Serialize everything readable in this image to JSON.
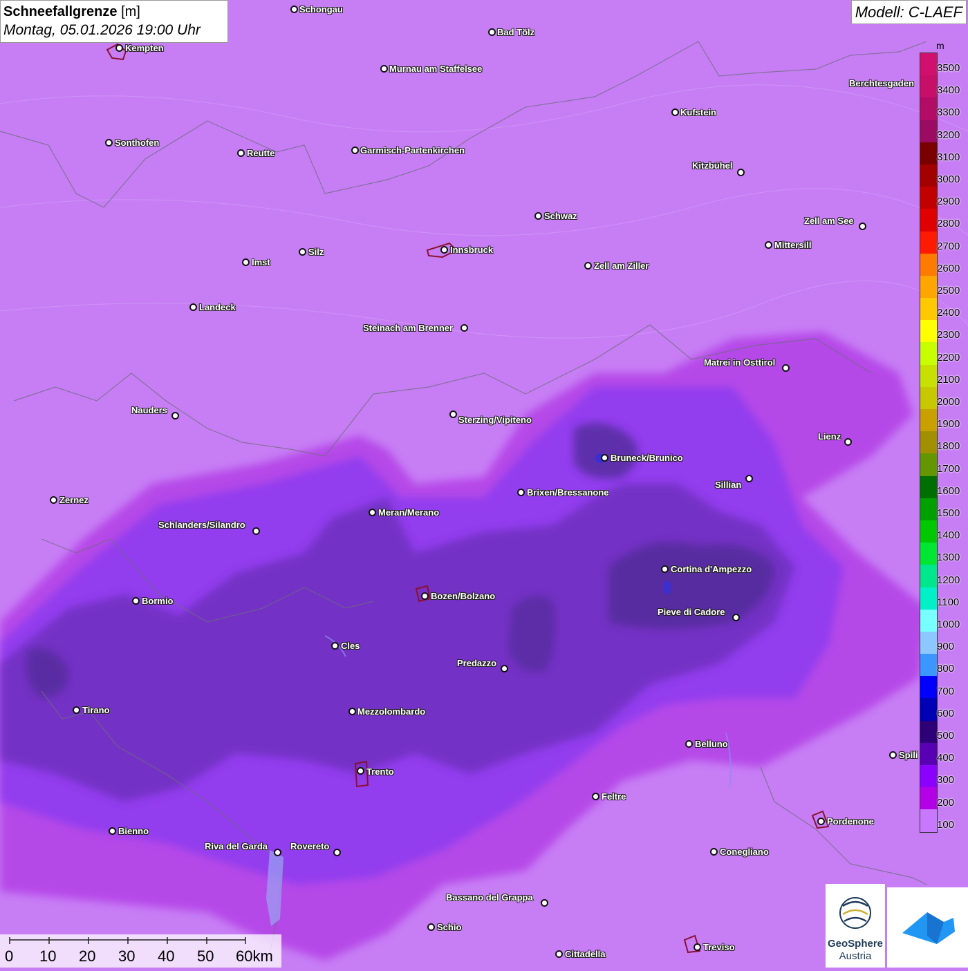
{
  "header": {
    "title": "Schneefallgrenze",
    "unit": "[m]",
    "datetime": "Montag, 05.01.2026 19:00 Uhr",
    "model": "Modell: C-LAEF"
  },
  "legend": {
    "unit": "m",
    "levels": [
      {
        "label": "3500",
        "color": "#d10f6e"
      },
      {
        "label": "3400",
        "color": "#c70e69"
      },
      {
        "label": "3300",
        "color": "#b20c66"
      },
      {
        "label": "3200",
        "color": "#9c0b62"
      },
      {
        "label": "3100",
        "color": "#7a0000"
      },
      {
        "label": "3000",
        "color": "#a30000"
      },
      {
        "label": "2900",
        "color": "#c30000"
      },
      {
        "label": "2800",
        "color": "#e00000"
      },
      {
        "label": "2700",
        "color": "#ff1a00"
      },
      {
        "label": "2600",
        "color": "#ff7a00"
      },
      {
        "label": "2500",
        "color": "#ffa500"
      },
      {
        "label": "2400",
        "color": "#ffc800"
      },
      {
        "label": "2300",
        "color": "#ffff00"
      },
      {
        "label": "2200",
        "color": "#c8ff00"
      },
      {
        "label": "2100",
        "color": "#c8e000"
      },
      {
        "label": "2000",
        "color": "#c8c800"
      },
      {
        "label": "1900",
        "color": "#c8a000"
      },
      {
        "label": "1800",
        "color": "#a09000"
      },
      {
        "label": "1700",
        "color": "#649600"
      },
      {
        "label": "1600",
        "color": "#006e00"
      },
      {
        "label": "1500",
        "color": "#00a000"
      },
      {
        "label": "1400",
        "color": "#00c800"
      },
      {
        "label": "1300",
        "color": "#00e632"
      },
      {
        "label": "1200",
        "color": "#00e68c"
      },
      {
        "label": "1100",
        "color": "#00f0c8"
      },
      {
        "label": "1000",
        "color": "#78ffff"
      },
      {
        "label": "900",
        "color": "#8cc8ff"
      },
      {
        "label": "800",
        "color": "#3c96ff"
      },
      {
        "label": "700",
        "color": "#0000ff"
      },
      {
        "label": "600",
        "color": "#0000b4"
      },
      {
        "label": "500",
        "color": "#2d0078"
      },
      {
        "label": "400",
        "color": "#5a00b4"
      },
      {
        "label": "300",
        "color": "#8c00ff"
      },
      {
        "label": "200",
        "color": "#b400e6"
      },
      {
        "label": "100",
        "color": "#c878ff"
      }
    ]
  },
  "cities": [
    {
      "name": "Schongau",
      "dot": true
    },
    {
      "name": "Bad Tölz",
      "dot": true
    },
    {
      "name": "Kempten",
      "dot": true
    },
    {
      "name": "Murnau am Staffelsee",
      "dot": true
    },
    {
      "name": "Berchtesgaden",
      "dot": false
    },
    {
      "name": "Kufstein",
      "dot": true
    },
    {
      "name": "Sonthofen",
      "dot": true
    },
    {
      "name": "Reutte",
      "dot": true
    },
    {
      "name": "Garmisch-Partenkirchen",
      "dot": true
    },
    {
      "name": "Kitzbühel",
      "dot": true
    },
    {
      "name": "Schwaz",
      "dot": true
    },
    {
      "name": "Zell am See",
      "dot": true
    },
    {
      "name": "Innsbruck",
      "dot": true
    },
    {
      "name": "Mittersill",
      "dot": true
    },
    {
      "name": "Silz",
      "dot": true
    },
    {
      "name": "Imst",
      "dot": true
    },
    {
      "name": "Zell am Ziller",
      "dot": true
    },
    {
      "name": "Landeck",
      "dot": true
    },
    {
      "name": "Steinach am Brenner",
      "dot": true
    },
    {
      "name": "Matrei in Osttirol",
      "dot": true
    },
    {
      "name": "Nauders",
      "dot": true
    },
    {
      "name": "Sterzing/Vipiteno",
      "dot": true
    },
    {
      "name": "Lienz",
      "dot": true
    },
    {
      "name": "Bruneck/Brunico",
      "dot": true
    },
    {
      "name": "Sillian",
      "dot": true
    },
    {
      "name": "Brixen/Bressanone",
      "dot": true
    },
    {
      "name": "Zernez",
      "dot": true
    },
    {
      "name": "Meran/Merano",
      "dot": true
    },
    {
      "name": "Schlanders/Silandro",
      "dot": true
    },
    {
      "name": "Cortina d'Ampezzo",
      "dot": true
    },
    {
      "name": "Bozen/Bolzano",
      "dot": true
    },
    {
      "name": "Bormio",
      "dot": true
    },
    {
      "name": "Pieve di Cadore",
      "dot": true
    },
    {
      "name": "Cles",
      "dot": true
    },
    {
      "name": "Predazzo",
      "dot": true
    },
    {
      "name": "Tirano",
      "dot": true
    },
    {
      "name": "Mezzolombardo",
      "dot": true
    },
    {
      "name": "Belluno",
      "dot": true
    },
    {
      "name": "Spili",
      "dot": true
    },
    {
      "name": "Trento",
      "dot": true
    },
    {
      "name": "Feltre",
      "dot": true
    },
    {
      "name": "Pordenone",
      "dot": true
    },
    {
      "name": "Bienno",
      "dot": true
    },
    {
      "name": "Riva del Garda",
      "dot": true
    },
    {
      "name": "Rovereto",
      "dot": true
    },
    {
      "name": "Conegliano",
      "dot": true
    },
    {
      "name": "Bassano del Grappa",
      "dot": true
    },
    {
      "name": "Schio",
      "dot": true
    },
    {
      "name": "Treviso",
      "dot": true
    },
    {
      "name": "Cittadella",
      "dot": true
    }
  ],
  "scalebar": {
    "labels": [
      "0",
      "10",
      "20",
      "30",
      "40",
      "50",
      "60km"
    ]
  },
  "logos": {
    "geosphere_line1": "GeoSphere",
    "geosphere_line2": "Austria"
  }
}
